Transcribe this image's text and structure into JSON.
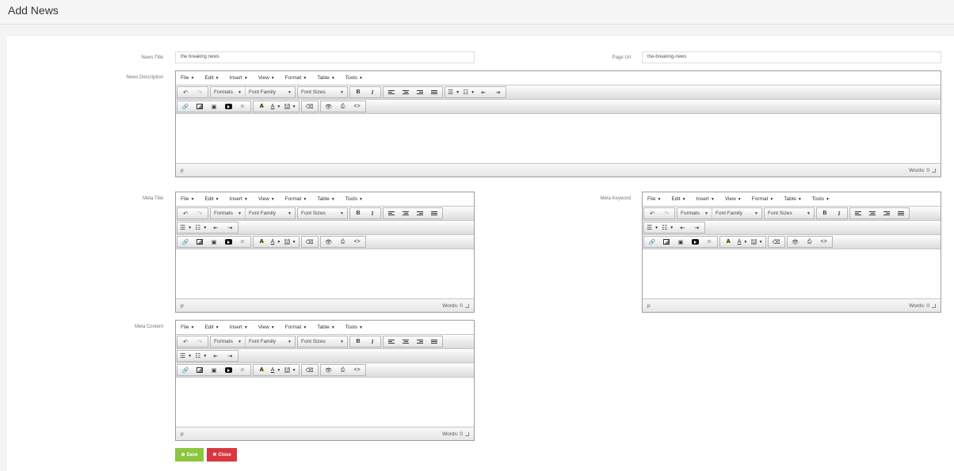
{
  "page": {
    "title": "Add News"
  },
  "form": {
    "news_title_label": "News Title",
    "news_title_value": "the breaking news",
    "page_url_label": "Page Url",
    "page_url_value": "the-breaking-news",
    "news_description_label": "News Description",
    "meta_title_label": "Meta Title",
    "meta_keyword_label": "Meta Keyword",
    "meta_content_label": "Meta Content"
  },
  "editor": {
    "menu": {
      "file": "File",
      "edit": "Edit",
      "insert": "Insert",
      "view": "View",
      "format": "Format",
      "table": "Table",
      "tools": "Tools"
    },
    "formats": "Formats",
    "font_family": "Font Family",
    "font_sizes": "Font Sizes",
    "bold": "B",
    "italic": "I",
    "code": "<>",
    "path": "p",
    "words": "Words: 0"
  },
  "buttons": {
    "save": "Save",
    "close": "Close"
  },
  "colors": {
    "save": "#8cc63f",
    "close": "#d9363e"
  }
}
